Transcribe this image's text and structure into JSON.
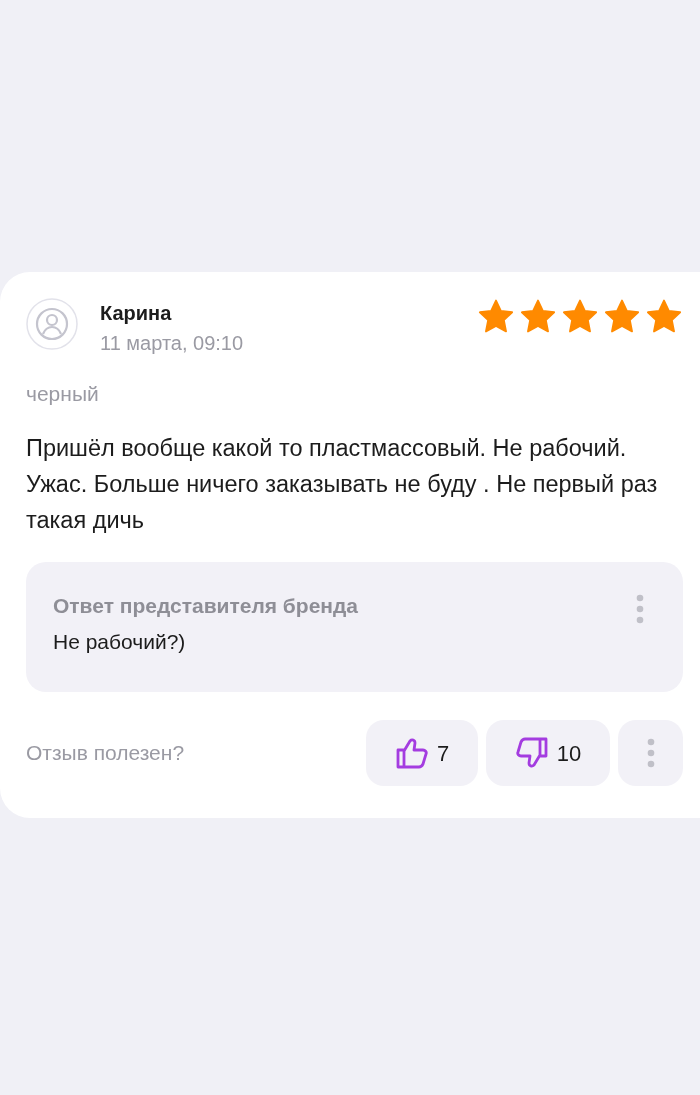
{
  "review": {
    "author": "Карина",
    "date": "11 марта, 09:10",
    "stars": 5,
    "variant": "черный",
    "text": "Пришёл вообще какой то пластмассовый. Не рабочий. Ужас. Больше ничего заказывать не буду . Не первый раз такая дичь"
  },
  "reply": {
    "title": "Ответ представителя бренда",
    "text": "Не рабочий?)"
  },
  "footer": {
    "question": "Отзыв полезен?",
    "likes": "7",
    "dislikes": "10"
  }
}
